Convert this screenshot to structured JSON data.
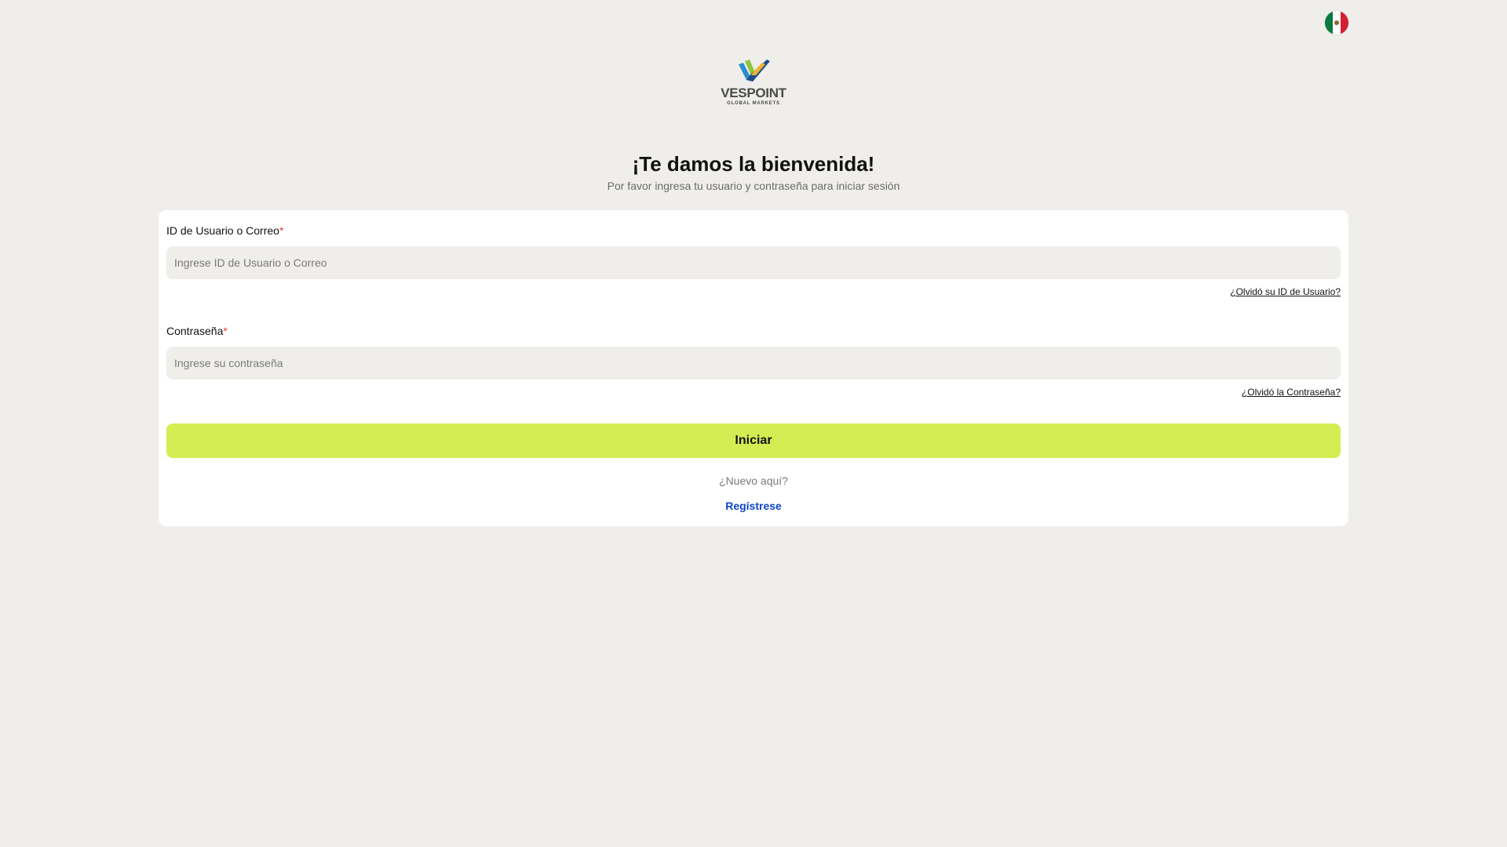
{
  "language": {
    "icon": "mexico-flag-icon"
  },
  "logo": {
    "brand": "VESPOINT",
    "tagline": "GLOBAL MARKETS",
    "icon": "vespoint-check-logo"
  },
  "header": {
    "title": "¡Te damos la bienvenida!",
    "subtitle": "Por favor ingresa tu usuario y contraseña para iniciar sesión"
  },
  "form": {
    "username": {
      "label": "ID de Usuario o Correo",
      "required_mark": "*",
      "placeholder": "Ingrese ID de Usuario o Correo",
      "value": "",
      "forgot_link": "¿Olvidó su ID de Usuario?"
    },
    "password": {
      "label": "Contraseña",
      "required_mark": "*",
      "placeholder": "Ingrese su contraseña",
      "value": "",
      "forgot_link": "¿Olvidó la Contraseña?"
    },
    "submit_label": "Iniciar",
    "new_here": "¿Nuevo aquí?",
    "register_link": "Regístrese"
  },
  "colors": {
    "background": "#efeeeb",
    "card": "#ffffff",
    "button": "#d4ed52",
    "link": "#0a46c8",
    "required": "#e23b3b"
  }
}
